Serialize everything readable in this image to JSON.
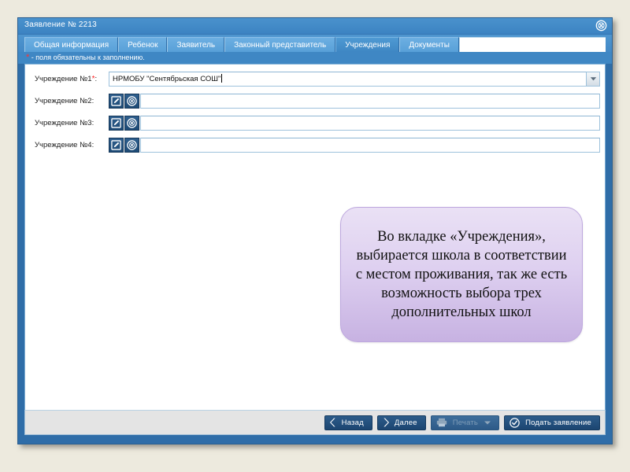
{
  "window": {
    "title": "Заявление № 2213",
    "close_icon": "close-circle-icon"
  },
  "tabs": [
    {
      "label": "Общая информация",
      "active": false
    },
    {
      "label": "Ребенок",
      "active": false
    },
    {
      "label": "Заявитель",
      "active": false
    },
    {
      "label": "Законный представитель",
      "active": false
    },
    {
      "label": "Учреждения",
      "active": true
    },
    {
      "label": "Документы",
      "active": false
    }
  ],
  "required_note": {
    "asterisk": "*",
    "text": " - поля обязательны к заполнению."
  },
  "form": {
    "rows": [
      {
        "label": "Учреждение №1",
        "required": true,
        "value": "НРМОБУ \"Сентябрьская СОШ\"",
        "placeholder": "",
        "has_dropdown": true,
        "has_icons": false,
        "caret": true
      },
      {
        "label": "Учреждение №2",
        "required": false,
        "value": "",
        "placeholder": "",
        "has_dropdown": false,
        "has_icons": true,
        "caret": false
      },
      {
        "label": "Учреждение №3",
        "required": false,
        "value": "",
        "placeholder": "",
        "has_dropdown": false,
        "has_icons": true,
        "caret": false
      },
      {
        "label": "Учреждение №4",
        "required": false,
        "value": "",
        "placeholder": "",
        "has_dropdown": false,
        "has_icons": true,
        "caret": false
      }
    ],
    "icons": {
      "edit": "edit-pencil-icon",
      "clear": "clear-circle-x-icon",
      "dropdown": "chevron-down-icon"
    }
  },
  "callout": {
    "text": "Во вкладке «Учреждения», выбирается школа в соответствии с местом проживания, так же есть возможность выбора трех дополнительных школ",
    "fill_top": "#e4d9f2",
    "fill_bottom": "#c9b5e4",
    "border": "#b79fdb"
  },
  "toolbar": {
    "buttons": [
      {
        "label": "Назад",
        "icon": "chevron-left-icon",
        "disabled": false
      },
      {
        "label": "Далее",
        "icon": "chevron-right-icon",
        "disabled": false
      },
      {
        "label": "Печать",
        "icon": "printer-icon",
        "disabled": true,
        "dropdown": true
      },
      {
        "label": "Подать заявление",
        "icon": "check-circle-icon",
        "disabled": false
      }
    ]
  },
  "colors": {
    "page_background": "#edeade",
    "window_chrome": "#2f6da8",
    "title_bar": "#3f87c4",
    "tab_inactive": "#58a0d8",
    "tab_active": "#3f87c4",
    "required_asterisk": "#ff2222",
    "button_blue": "#1c4571"
  }
}
